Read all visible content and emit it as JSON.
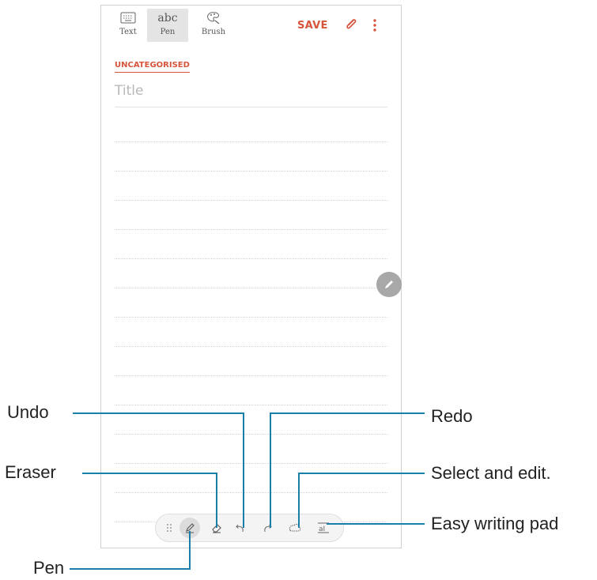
{
  "toolbar": {
    "text_label": "Text",
    "pen_label": "Pen",
    "pen_glyph": "abc",
    "brush_label": "Brush",
    "save_label": "SAVE",
    "icons": [
      "keyboard-icon",
      "handwriting-icon",
      "brush-palette-icon",
      "paperclip-icon",
      "more-options-icon"
    ]
  },
  "note": {
    "category": "UNCATEGORISED",
    "title_placeholder": "Title"
  },
  "pen_toolbar": {
    "tools": [
      "drag-handle-icon",
      "pen-icon",
      "eraser-icon",
      "undo-icon",
      "redo-icon",
      "select-lasso-icon",
      "easy-writing-pad-icon"
    ],
    "active_tool": "pen",
    "easy_pad_glyph": "aI"
  },
  "callouts": {
    "undo": "Undo",
    "redo": "Redo",
    "eraser": "Eraser",
    "select": "Select and edit.",
    "pen": "Pen",
    "easy_pad": "Easy writing pad"
  },
  "colors": {
    "accent": "#d6553c",
    "leader_line": "#1a7fa8"
  }
}
